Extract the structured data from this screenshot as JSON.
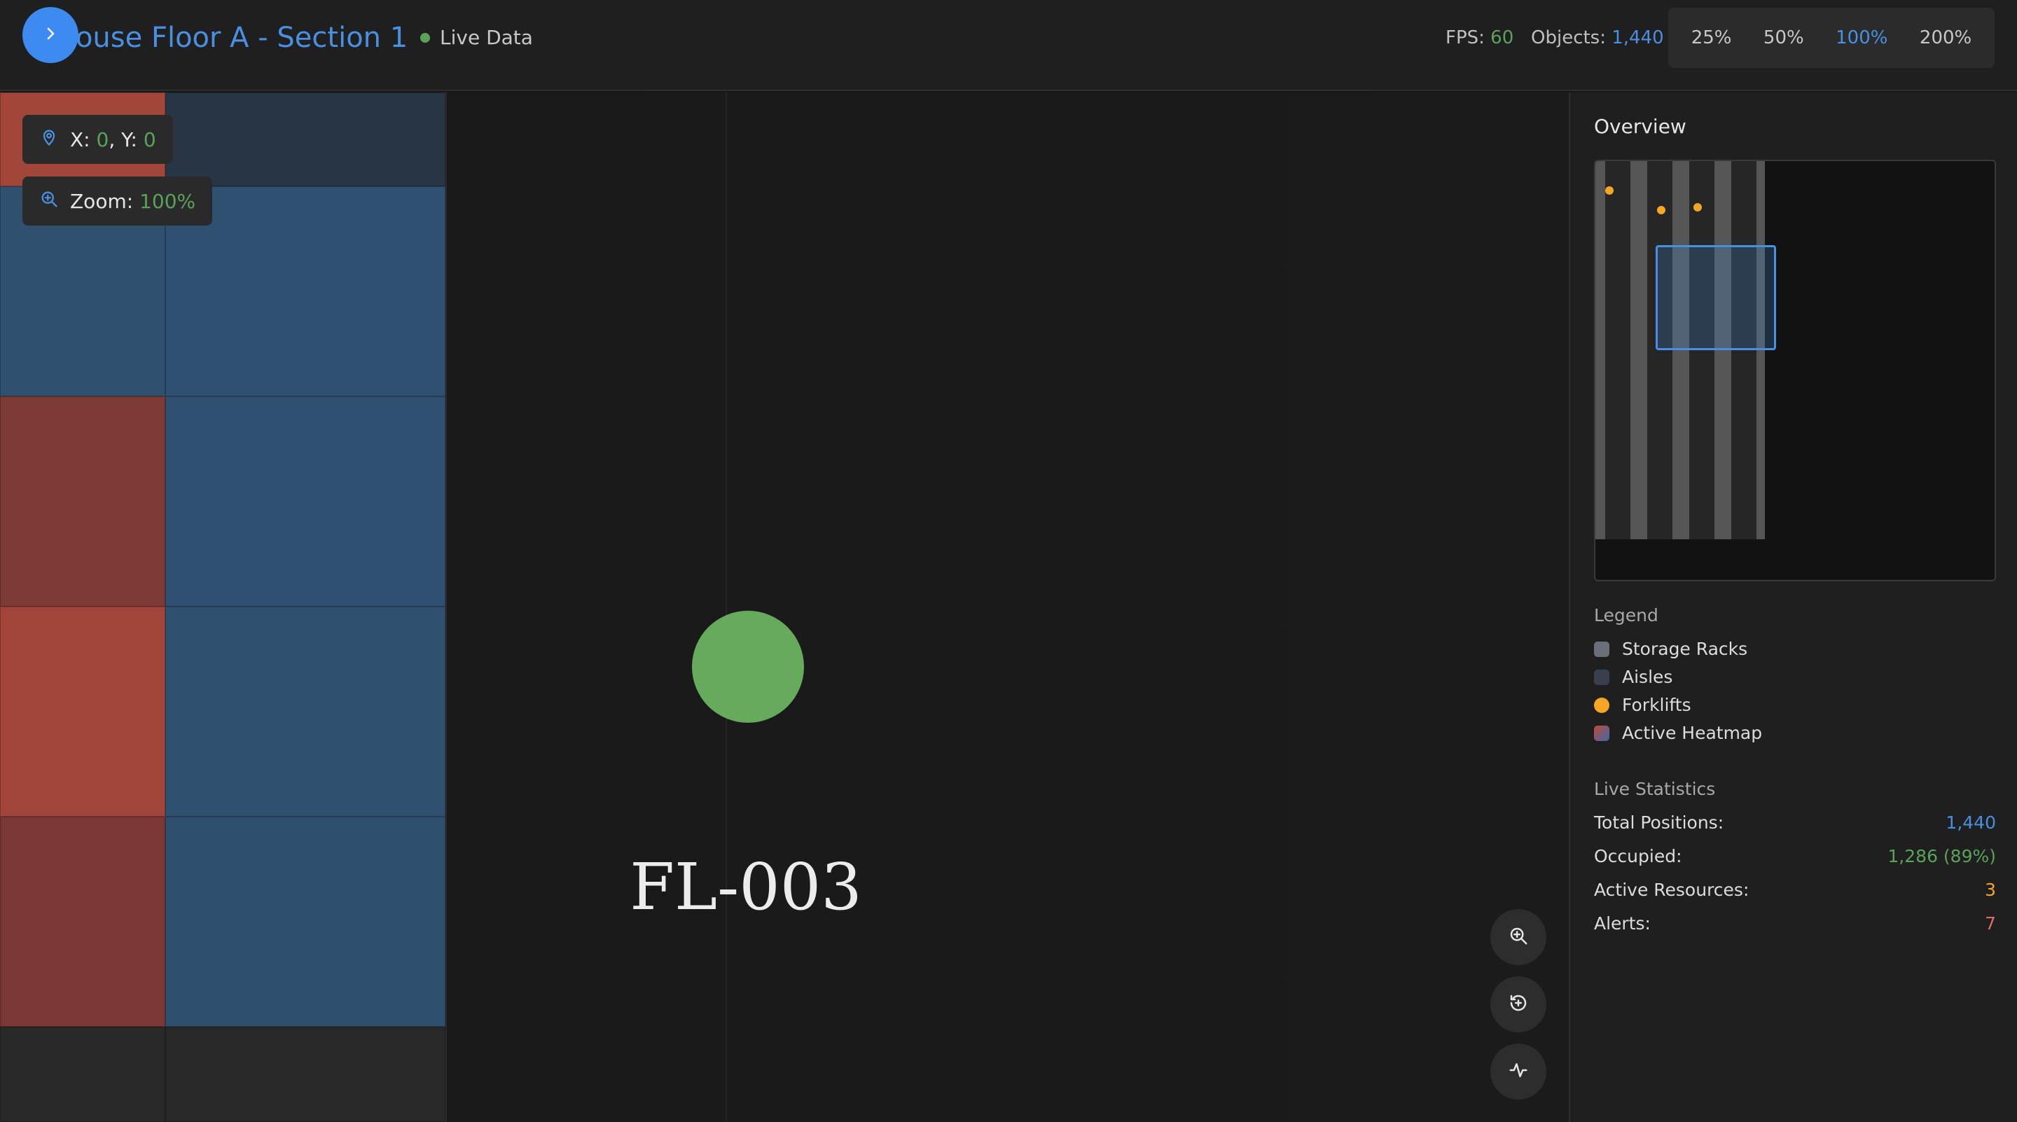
{
  "header": {
    "title": "Warehouse Floor A - Section 1",
    "title_visible": "ehouse Floor A - Section 1",
    "status": "Live Data",
    "fps_label": "FPS:",
    "fps_value": "60",
    "objects_label": "Objects:",
    "objects_value": "1,440",
    "zoom_options": [
      "25%",
      "50%",
      "100%",
      "200%"
    ],
    "zoom_selected": "100%"
  },
  "canvas": {
    "coords_x_label": "X:",
    "coords_x": "0",
    "coords_sep": ", Y:",
    "coords_y": "0",
    "zoom_label": "Zoom:",
    "zoom_value": "100%",
    "forklift_label": "FL-003",
    "forklift_color": "#66aa5c",
    "controls": [
      "zoom-in-icon",
      "recenter-icon",
      "activity-icon"
    ]
  },
  "sidebar": {
    "overview_title": "Overview",
    "legend_title": "Legend",
    "legend": [
      {
        "label": "Storage Racks",
        "color": "#6b6f78"
      },
      {
        "label": "Aisles",
        "color": "#3a3f4d"
      },
      {
        "label": "Forklifts",
        "color": "#f5a623"
      },
      {
        "label": "Active Heatmap",
        "color": "#7a5a9e"
      }
    ],
    "stats_title": "Live Statistics",
    "stats": [
      {
        "label": "Total Positions:",
        "value": "1,440",
        "color": "#4a90e2"
      },
      {
        "label": "Occupied:",
        "value": "1,286 (89%)",
        "color": "#5aa25a"
      },
      {
        "label": "Active Resources:",
        "value": "3",
        "color": "#f5a623"
      },
      {
        "label": "Alerts:",
        "value": "7",
        "color": "#e06c5c"
      }
    ]
  },
  "colors": {
    "accent": "#4a90e2",
    "heat_red": "#a3463a",
    "heat_blue": "#305070",
    "positive": "#5aa25a"
  }
}
